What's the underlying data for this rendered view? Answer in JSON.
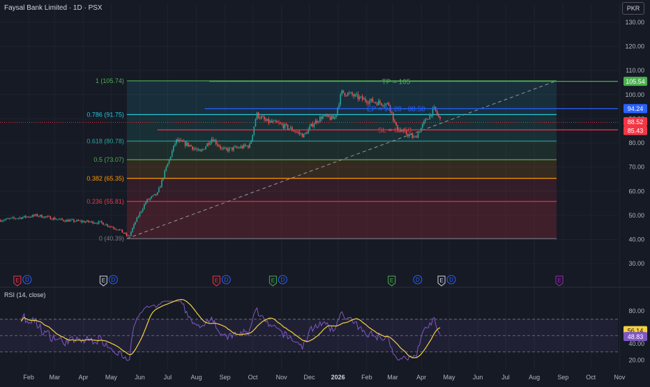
{
  "header": {
    "title": "Faysal Bank Limited · 1D · PSX",
    "currency": "PKR"
  },
  "rsi_label": "RSI (14, close)",
  "chart_data": [
    {
      "type": "line",
      "subtype": "candlestick",
      "title": "Faysal Bank Limited · 1D · PSX",
      "xlabel": "",
      "ylabel": "",
      "ylim": [
        26,
        132
      ],
      "yticks": [
        "130.00",
        "120.00",
        "110.00",
        "100.00",
        "90.00",
        "80.00",
        "70.00",
        "60.00",
        "50.00",
        "40.00",
        "30.00"
      ],
      "xticks": [
        "Feb",
        "Mar",
        "Apr",
        "May",
        "Jun",
        "Jul",
        "Aug",
        "Sep",
        "Oct",
        "Nov",
        "Dec",
        "2026",
        "Feb",
        "Mar",
        "Apr",
        "May",
        "Jun",
        "Jul",
        "Aug",
        "Sep",
        "Oct",
        "Nov"
      ],
      "price_path": [
        {
          "x": "2025-01-01",
          "y": 48
        },
        {
          "x": "2025-02-10",
          "y": 50
        },
        {
          "x": "2025-03-10",
          "y": 48
        },
        {
          "x": "2025-04-20",
          "y": 47
        },
        {
          "x": "2025-05-10",
          "y": 44
        },
        {
          "x": "2025-05-20",
          "y": 41
        },
        {
          "x": "2025-05-28",
          "y": 48
        },
        {
          "x": "2025-06-08",
          "y": 56
        },
        {
          "x": "2025-06-20",
          "y": 59
        },
        {
          "x": "2025-06-28",
          "y": 68
        },
        {
          "x": "2025-07-10",
          "y": 81
        },
        {
          "x": "2025-07-25",
          "y": 79
        },
        {
          "x": "2025-08-05",
          "y": 76
        },
        {
          "x": "2025-08-18",
          "y": 82
        },
        {
          "x": "2025-08-30",
          "y": 77
        },
        {
          "x": "2025-09-15",
          "y": 78
        },
        {
          "x": "2025-09-28",
          "y": 79
        },
        {
          "x": "2025-10-05",
          "y": 92
        },
        {
          "x": "2025-10-15",
          "y": 89
        },
        {
          "x": "2025-10-28",
          "y": 88
        },
        {
          "x": "2025-11-10",
          "y": 86
        },
        {
          "x": "2025-11-25",
          "y": 83
        },
        {
          "x": "2025-12-05",
          "y": 88
        },
        {
          "x": "2025-12-15",
          "y": 91
        },
        {
          "x": "2025-12-28",
          "y": 90
        },
        {
          "x": "2026-01-05",
          "y": 101
        },
        {
          "x": "2026-01-15",
          "y": 100
        },
        {
          "x": "2026-01-28",
          "y": 98
        },
        {
          "x": "2026-02-10",
          "y": 97
        },
        {
          "x": "2026-02-25",
          "y": 96
        },
        {
          "x": "2026-03-05",
          "y": 86
        },
        {
          "x": "2026-03-15",
          "y": 84
        },
        {
          "x": "2026-03-25",
          "y": 82
        },
        {
          "x": "2026-04-05",
          "y": 89
        },
        {
          "x": "2026-04-15",
          "y": 94
        },
        {
          "x": "2026-04-22",
          "y": 89
        }
      ],
      "fibonacci": [
        {
          "label": "1 (105.74)",
          "value": 105.74,
          "color": "#4caf50"
        },
        {
          "label": "0.786 (91.75)",
          "value": 91.75,
          "color": "#26c6da"
        },
        {
          "label": "0.618 (80.78)",
          "value": 80.78,
          "color": "#26a69a"
        },
        {
          "label": "0.5 (73.07)",
          "value": 73.07,
          "color": "#4caf50"
        },
        {
          "label": "0.382 (65.35)",
          "value": 65.35,
          "color": "#ff9800"
        },
        {
          "label": "0.236 (55.81)",
          "value": 55.81,
          "color": "#f23645"
        },
        {
          "label": "0 (40.39)",
          "value": 40.39,
          "color": "#787b86"
        }
      ],
      "fib_range": {
        "x_start": "2025-05-18",
        "x_end": "2026-08-25"
      },
      "trend_line": {
        "from": {
          "x": "2025-05-18",
          "y": 40.39
        },
        "to": {
          "x": "2026-08-25",
          "y": 105.74
        }
      },
      "annotations": [
        {
          "text": "TP = 105",
          "value": 105.54,
          "color": "#4caf50"
        },
        {
          "text": "EP = 94.20 - 88.50",
          "value": 94.24,
          "color": "#2962ff"
        },
        {
          "text": "SL = 85.50",
          "value": 85.43,
          "color": "#f23645"
        }
      ],
      "price_badges": [
        {
          "text": "105.54",
          "value": 105.54,
          "color": "#4caf50"
        },
        {
          "text": "94.24",
          "value": 94.24,
          "color": "#2962ff"
        },
        {
          "text": "88.52",
          "value": 88.52,
          "color": "#f23645"
        },
        {
          "text": "85.43",
          "value": 85.43,
          "color": "#f23645"
        }
      ],
      "events": [
        {
          "x": "2025-01-25",
          "marks": [
            "E",
            "D"
          ]
        },
        {
          "x": "2025-04-28",
          "marks": [
            "E",
            "D"
          ]
        },
        {
          "x": "2025-08-28",
          "marks": [
            "E",
            "D"
          ]
        },
        {
          "x": "2025-10-28",
          "marks": [
            "E",
            "D"
          ]
        },
        {
          "x": "2026-02-28",
          "marks": [
            "E"
          ]
        },
        {
          "x": "2026-03-28",
          "marks": [
            "D"
          ]
        },
        {
          "x": "2026-04-28",
          "marks": [
            "E",
            "D"
          ]
        },
        {
          "x": "2026-08-28",
          "marks": [
            "E"
          ]
        }
      ],
      "grid": true,
      "legend": "none"
    },
    {
      "type": "line",
      "title": "RSI (14, close)",
      "ylim": [
        17,
        92
      ],
      "yticks": [
        "80.00",
        "40.00",
        "20.00"
      ],
      "bands": [
        30,
        50,
        70
      ],
      "badges": [
        {
          "text": "56.14",
          "value": 56.14,
          "color": "#f5d142"
        },
        {
          "text": "48.83",
          "value": 48.83,
          "color": "#7e57c2"
        }
      ],
      "series": []
    }
  ]
}
